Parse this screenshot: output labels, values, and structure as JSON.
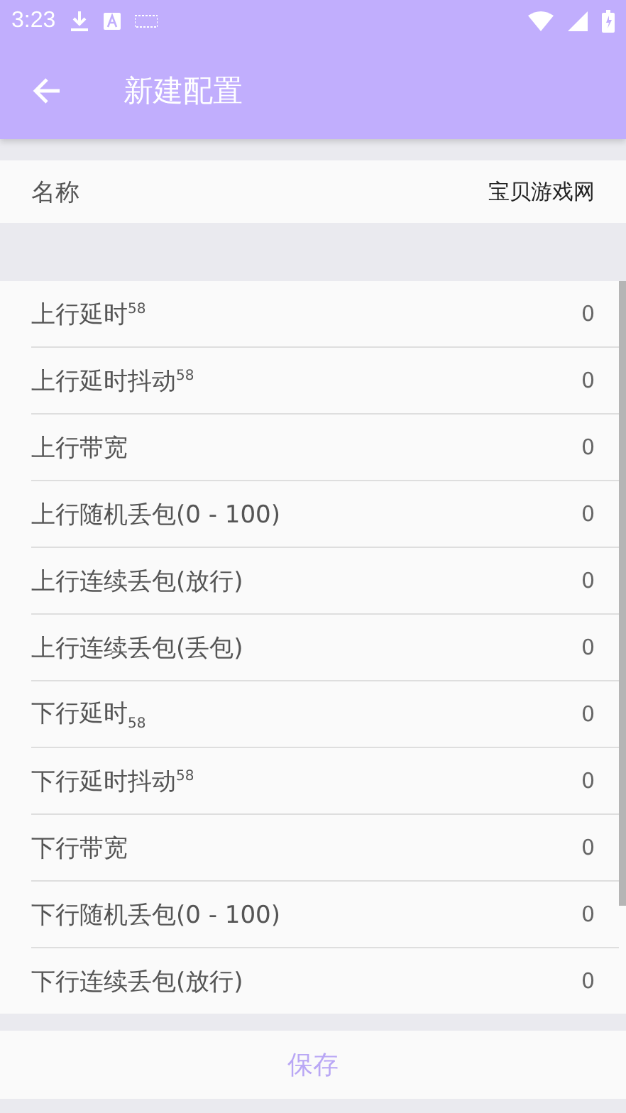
{
  "status_bar": {
    "time": "3:23"
  },
  "toolbar": {
    "title": "新建配置"
  },
  "name_row": {
    "label": "名称",
    "value": "宝贝游戏网"
  },
  "settings": [
    {
      "label": "上行延时$^{58}$",
      "value": "0"
    },
    {
      "label": "上行延时抖动$^{58}$",
      "value": "0"
    },
    {
      "label": "上行带宽",
      "value": "0"
    },
    {
      "label": "上行随机丢包(0 - 100)",
      "value": "0"
    },
    {
      "label": "上行连续丢包(放行)",
      "value": "0"
    },
    {
      "label": "上行连续丢包(丢包)",
      "value": "0"
    },
    {
      "label": "下行延时$_{58}$",
      "value": "0"
    },
    {
      "label": "下行延时抖动$^{58}$",
      "value": "0"
    },
    {
      "label": "下行带宽",
      "value": "0"
    },
    {
      "label": "下行随机丢包(0 - 100)",
      "value": "0"
    },
    {
      "label": "下行连续丢包(放行)",
      "value": "0"
    }
  ],
  "save_button": "保存"
}
